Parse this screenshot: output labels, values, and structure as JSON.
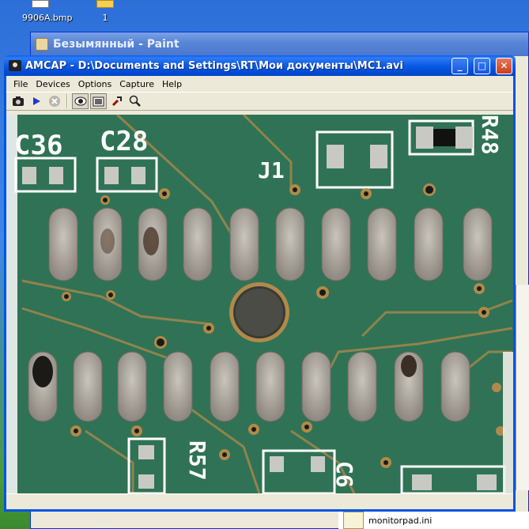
{
  "desktop": {
    "icon1_label": "9906A.bmp",
    "icon2_label": "1"
  },
  "paint": {
    "title": "Безымянный - Paint"
  },
  "amcap": {
    "title": "AMCAP - D:\\Documents and Settings\\RT\\Мои документы\\MC1.avi",
    "min_label": "_",
    "max_label": "□",
    "close_label": "✕",
    "menu": [
      "File",
      "Devices",
      "Options",
      "Capture",
      "Help"
    ],
    "toolbar_icons": [
      "camera-icon",
      "play-icon",
      "stop-icon",
      "preview-icon",
      "overlay-icon",
      "properties-icon",
      "zoom-icon"
    ],
    "video_labels": [
      "C36",
      "C28",
      "J1",
      "R57",
      "C6",
      "R48"
    ]
  },
  "taskbar": {
    "file_label": "monitorpad.ini"
  },
  "colors": {
    "board": "#2f6e52",
    "pad": "#a8a39c",
    "trace": "#b08a4a",
    "silk": "#ffffff"
  }
}
